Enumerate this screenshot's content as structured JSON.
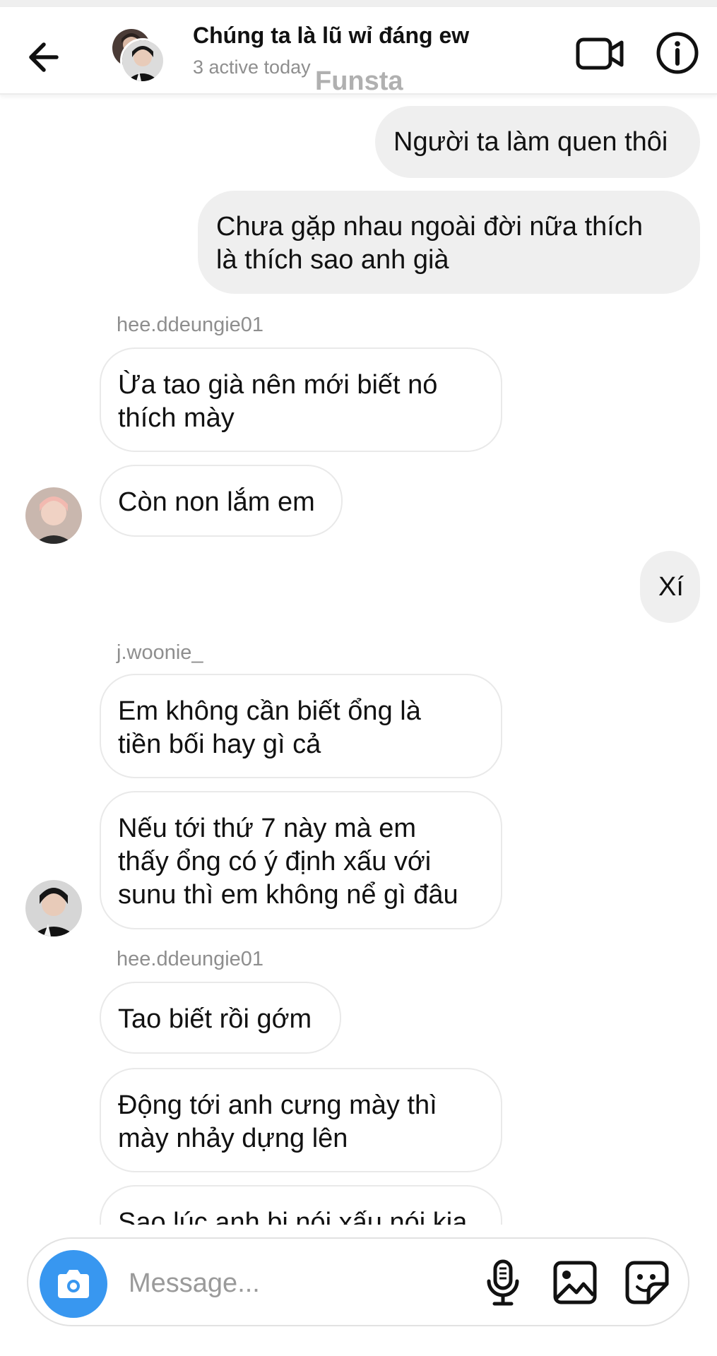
{
  "header": {
    "title": "Chúng ta là lũ wỉ đáng ew",
    "subtitle": "3 active today",
    "watermark": "Funsta"
  },
  "messages": [
    {
      "type": "sent",
      "text": "Người ta làm quen thôi"
    },
    {
      "type": "sent",
      "line1": "Chưa gặp nhau ngoài đời nữa thích",
      "line2": "là thích sao anh già"
    },
    {
      "type": "sender_label",
      "text": "hee.ddeungie01"
    },
    {
      "type": "received",
      "line1": "Ừa tao già nên mới biết nó",
      "line2": "thích mày"
    },
    {
      "type": "received",
      "text": "Còn non lắm em"
    },
    {
      "type": "sent",
      "text": "Xí"
    },
    {
      "type": "sender_label",
      "text": "j.woonie_"
    },
    {
      "type": "received",
      "line1": "Em không cần biết ổng là",
      "line2": "tiền bối hay gì cả"
    },
    {
      "type": "received",
      "line1": "Nếu tới thứ 7 này mà em",
      "line2": "thấy ổng có ý định xấu với",
      "line3": "sunu thì em không nể gì đâu"
    },
    {
      "type": "sender_label",
      "text": "hee.ddeungie01"
    },
    {
      "type": "received",
      "text": "Tao biết rồi gớm"
    },
    {
      "type": "received",
      "line1": "Động tới anh cưng mày thì",
      "line2": "mày nhảy dựng lên"
    },
    {
      "type": "received",
      "text": "Sao lúc anh bị nói xấu nói kia"
    }
  ],
  "composer": {
    "placeholder": "Message..."
  },
  "colors": {
    "accent": "#3897f0",
    "sent_bubble": "#efefef",
    "received_border": "#e9e9e9",
    "secondary_text": "#8e8e8e"
  },
  "icons": [
    "back-arrow-icon",
    "video-call-icon",
    "info-icon",
    "camera-icon",
    "microphone-icon",
    "gallery-icon",
    "sticker-icon"
  ]
}
